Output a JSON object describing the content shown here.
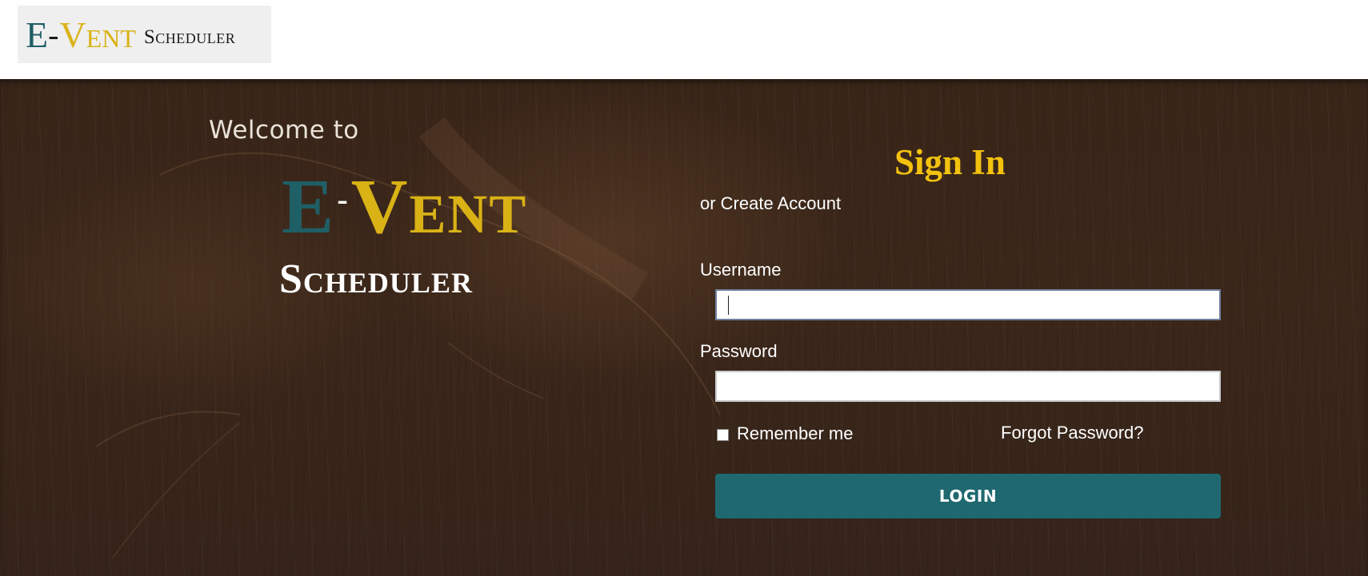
{
  "header": {
    "logo": {
      "e": "E",
      "dash": "-",
      "vent": "Vent",
      "scheduler": "Scheduler"
    }
  },
  "hero": {
    "welcome": "Welcome to",
    "logo": {
      "e": "E",
      "dash": "-",
      "vent": "Vent",
      "scheduler": "Scheduler"
    }
  },
  "signin": {
    "title": "Sign In",
    "create_account": "or Create Account",
    "username_label": "Username",
    "username_value": "",
    "password_label": "Password",
    "password_value": "",
    "remember_label": "Remember me",
    "remember_checked": false,
    "forgot_label": "Forgot Password?",
    "login_label": "LOGIN"
  },
  "colors": {
    "teal": "#1f5f66",
    "gold": "#d9b216",
    "title_yellow": "#f2c20f",
    "button": "#1f6870",
    "wood": "#3a2619"
  }
}
